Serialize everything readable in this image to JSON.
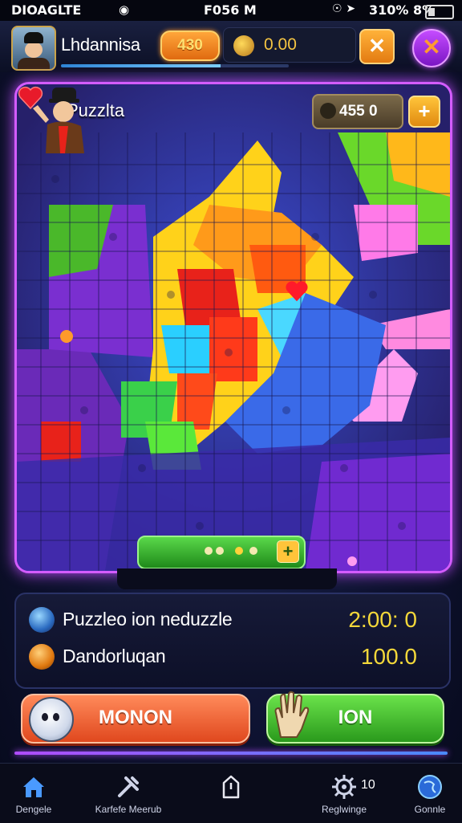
{
  "status_bar": {
    "carrier": "DIOAGLTE",
    "time": "F056 M",
    "battery_text": "310% 8%"
  },
  "top_bar": {
    "player_name": "Lhdannisa",
    "gems": "430",
    "coins": "0.00"
  },
  "board": {
    "title": "Puzzlta",
    "score": "455 0"
  },
  "info": [
    {
      "label": "Puzzleo ion neduzzle",
      "value": "2:00: 0",
      "icon": "blue-orb-icon"
    },
    {
      "label": "Dandorluqan",
      "value": "100.0",
      "icon": "orange-orb-icon"
    }
  ],
  "buttons": {
    "left": "MONON",
    "right": "ION"
  },
  "nav": {
    "items": [
      {
        "label": "Dengele",
        "icon": "home-icon"
      },
      {
        "label": "Karfefe Meerub",
        "icon": "tools-icon"
      },
      {
        "label": "",
        "icon": "share-icon"
      },
      {
        "label": "Reglwinge",
        "icon": "settings-icon"
      },
      {
        "label": "Gonnle",
        "icon": "globe-icon"
      }
    ],
    "count": "10"
  },
  "colors": {
    "accent_purple": "#d45cff",
    "gold": "#f4d83a",
    "green": "#2a9a1c",
    "orange": "#e0481e"
  }
}
